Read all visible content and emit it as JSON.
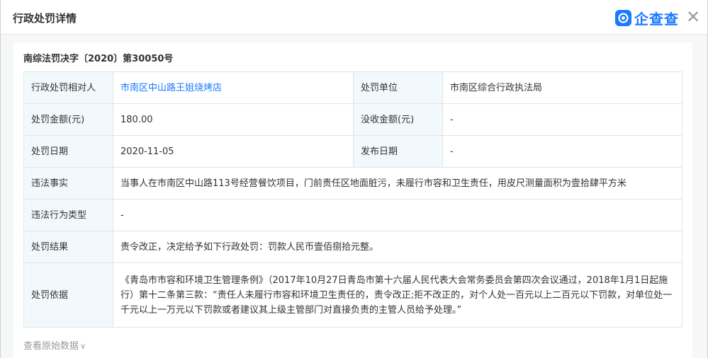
{
  "header": {
    "title": "行政处罚详情",
    "brand": "企查查",
    "close_icon": "close-icon"
  },
  "document": {
    "number": "南综法罚决字〔2020〕第30050号"
  },
  "rows": {
    "party_label": "行政处罚相对人",
    "party_value": "市南区中山路王姐烧烤店",
    "unit_label": "处罚单位",
    "unit_value": "市南区综合行政执法局",
    "amount_label": "处罚金额(元)",
    "amount_value": "180.00",
    "confiscate_label": "没收金额(元)",
    "confiscate_value": "-",
    "date_label": "处罚日期",
    "date_value": "2020-11-05",
    "publish_label": "发布日期",
    "publish_value": "-",
    "facts_label": "违法事实",
    "facts_value": "当事人在市南区中山路113号经营餐饮项目，门前责任区地面脏污，未履行市容和卫生责任，用皮尺测量面积为壹拾肆平方米",
    "type_label": "违法行为类型",
    "type_value": "-",
    "result_label": "处罚结果",
    "result_value": "责令改正，决定给予如下行政处罚：罚款人民币壹佰捌拾元整。",
    "basis_label": "处罚依据",
    "basis_value": "《青岛市市容和环境卫生管理条例》（2017年10月27日青岛市第十六届人民代表大会常务委员会第四次会议通过，2018年1月1日起施行）第十二条第三款：“责任人未履行市容和环境卫生责任的，责令改正;拒不改正的，对个人处一百元以上二百元以下罚款，对单位处一千元以上一万元以下罚款或者建议其上级主管部门对直接负责的主管人员给予处理。”"
  },
  "footer": {
    "view_raw": "查看原始数据"
  },
  "colors": {
    "accent": "#1a79ff",
    "label_bg": "#f2f9fc"
  }
}
